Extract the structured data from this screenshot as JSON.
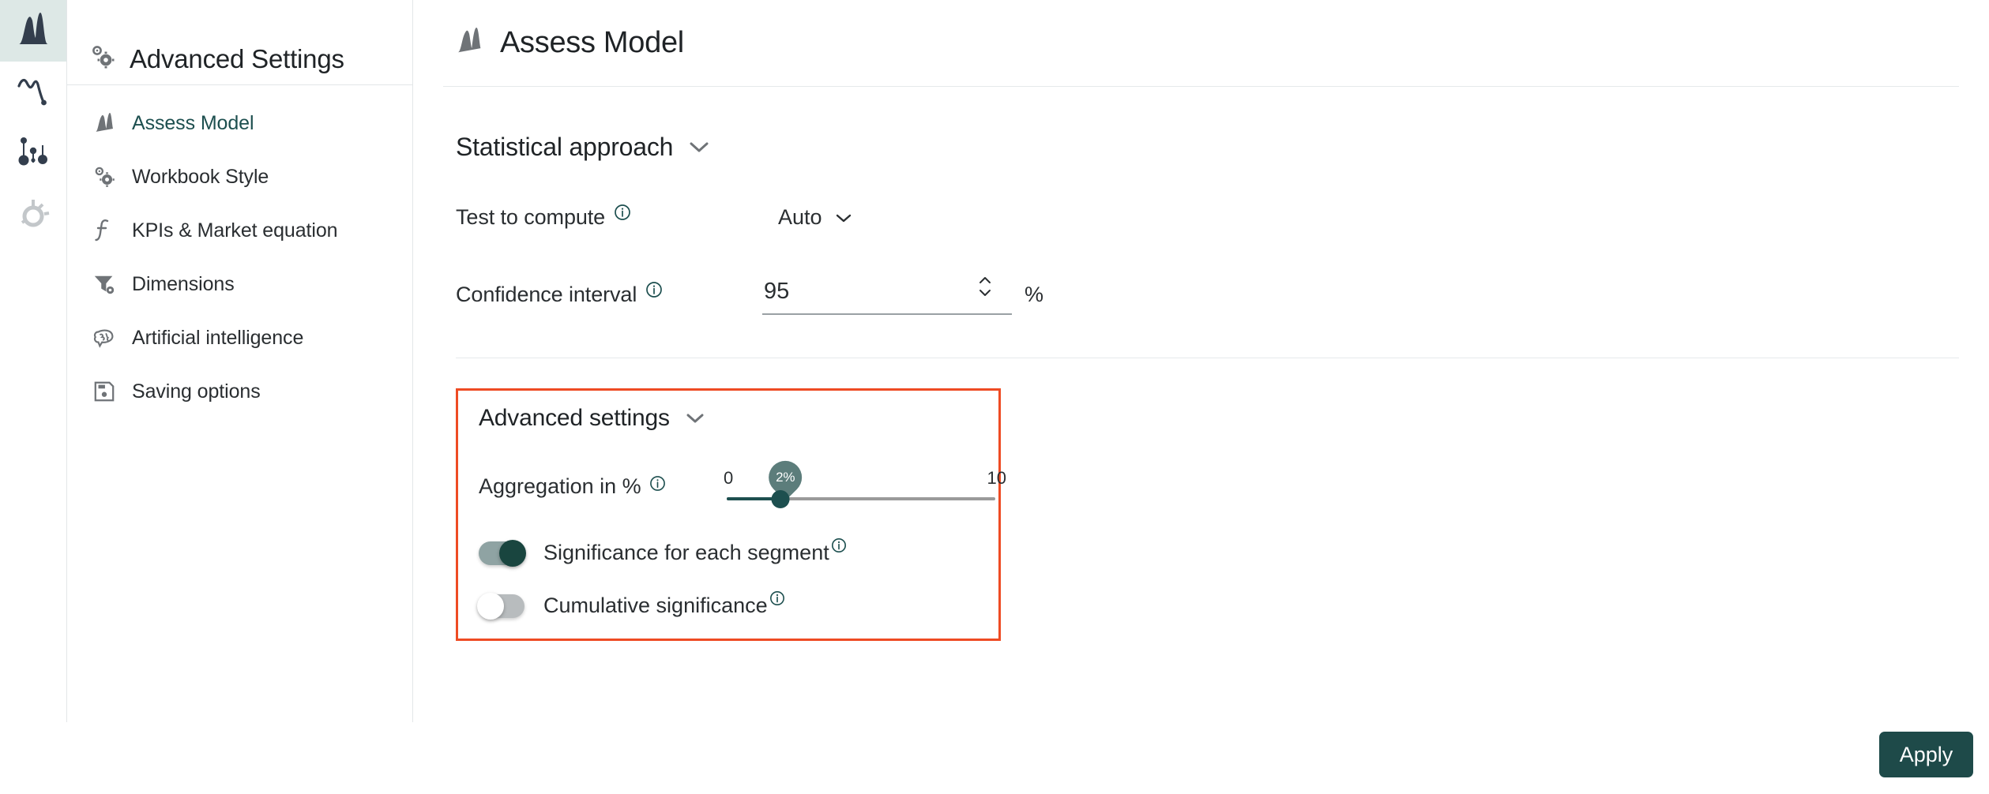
{
  "rail": {
    "items": [
      {
        "name": "distribution-icon",
        "active": true
      },
      {
        "name": "trend-line-icon",
        "active": false
      },
      {
        "name": "scatter-dots-icon",
        "active": false
      },
      {
        "name": "settings-dial-icon",
        "active": false
      }
    ]
  },
  "nav": {
    "header": {
      "title": "Advanced Settings",
      "icon": "gears-icon"
    },
    "items": [
      {
        "label": "Assess Model",
        "icon": "distribution-icon",
        "selected": true
      },
      {
        "label": "Workbook Style",
        "icon": "gears-icon",
        "selected": false
      },
      {
        "label": "KPIs & Market equation",
        "icon": "function-icon",
        "selected": false
      },
      {
        "label": "Dimensions",
        "icon": "filter-gear-icon",
        "selected": false
      },
      {
        "label": "Artificial intelligence",
        "icon": "brain-icon",
        "selected": false
      },
      {
        "label": "Saving options",
        "icon": "save-icon",
        "selected": false
      }
    ]
  },
  "main": {
    "title": "Assess Model",
    "title_icon": "distribution-icon",
    "statistical_approach": {
      "heading": "Statistical approach",
      "test_to_compute": {
        "label": "Test to compute",
        "value": "Auto"
      },
      "confidence_interval": {
        "label": "Confidence interval",
        "value": "95",
        "unit": "%"
      }
    },
    "advanced_settings": {
      "heading": "Advanced settings",
      "highlight_color": "#ee4b23",
      "aggregation": {
        "label": "Aggregation in %",
        "value": "2%",
        "min": "0",
        "max": "10"
      },
      "toggles": [
        {
          "label": "Significance for each segment",
          "state": "on"
        },
        {
          "label": "Cumulative significance",
          "state": "off"
        }
      ]
    }
  },
  "footer": {
    "apply_label": "Apply"
  },
  "colors": {
    "accent_teal": "#1d4f4f",
    "highlight_red": "#ee4b23",
    "rail_active_bg": "#dde8e6"
  }
}
